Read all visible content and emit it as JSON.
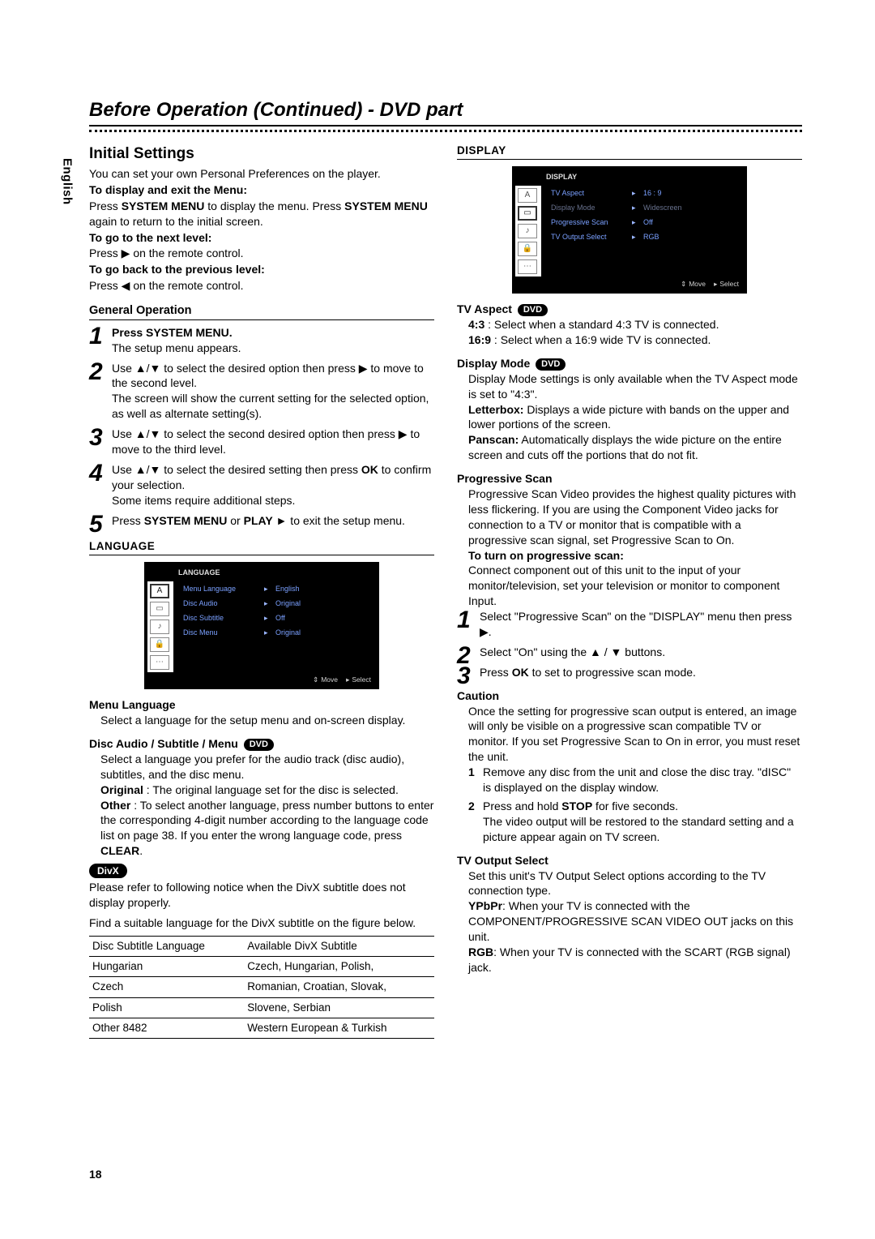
{
  "page_number": "18",
  "language_tab": "English",
  "title": "Before Operation (Continued) - DVD part",
  "initial_settings": {
    "heading": "Initial Settings",
    "intro1": "You can set your own Personal Preferences on the player.",
    "disp_exit_h": "To display and exit the Menu:",
    "disp_exit_t1": "Press ",
    "disp_exit_b1": "SYSTEM MENU",
    "disp_exit_t2": " to display the menu. Press ",
    "disp_exit_b2": "SYSTEM MENU",
    "disp_exit_t3": " again to return to the initial screen.",
    "next_h": "To go to the next level:",
    "next_t": "Press ▶ on the remote control.",
    "prev_h": "To go back to the previous level:",
    "prev_t": "Press ◀ on the remote control.",
    "general_op_h": "General Operation",
    "steps": {
      "s1a": "Press SYSTEM MENU.",
      "s1b": "The setup menu appears.",
      "s2a": "Use ▲/▼ to select the desired option then press ▶ to move to the second level.",
      "s2b": "The screen will show the current setting for the selected option, as well as alternate setting(s).",
      "s3": "Use ▲/▼ to select the second desired option then press ▶ to move to the third level.",
      "s4a_1": "Use ▲/▼ to select the desired setting then press ",
      "s4a_b": "OK",
      "s4a_2": " to confirm your selection.",
      "s4b": "Some items require additional steps.",
      "s5_1": "Press ",
      "s5_b1": "SYSTEM MENU",
      "s5_2": " or ",
      "s5_b2": "PLAY",
      "s5_3": " ► to exit the setup menu."
    }
  },
  "language": {
    "heading": "LANGUAGE",
    "osd_title": "LANGUAGE",
    "rows": [
      {
        "label": "Menu Language",
        "value": "English"
      },
      {
        "label": "Disc Audio",
        "value": "Original"
      },
      {
        "label": "Disc Subtitle",
        "value": "Off"
      },
      {
        "label": "Disc Menu",
        "value": "Original"
      }
    ],
    "osd_footer_move": "Move",
    "osd_footer_select": "Select",
    "menu_lang_h": "Menu Language",
    "menu_lang_t": "Select a language for the setup menu and on-screen display.",
    "dasm_h": "Disc Audio / Subtitle / Menu",
    "dasm_pill": "DVD",
    "dasm_t": "Select a language you prefer for the audio track (disc audio), subtitles, and the disc menu.",
    "orig_b": "Original",
    "orig_t": " : The original language set for the disc is selected.",
    "other_b": "Other",
    "other_t": " : To select another language, press number buttons to enter the corresponding 4-digit number according to the language code list on page 38. If you enter the wrong language code, press ",
    "other_clear": "CLEAR",
    "divx_pill": "DivX",
    "divx_t1": "Please refer to following notice when the DivX subtitle does not display properly.",
    "divx_t2": "Find a suitable language for the DivX subtitle on the figure below.",
    "table_h1": "Disc Subtitle Language",
    "table_h2": "Available DivX Subtitle",
    "table_rows": [
      {
        "c1": "Hungarian",
        "c2": "Czech, Hungarian, Polish,"
      },
      {
        "c1": "Czech",
        "c2": "Romanian, Croatian, Slovak,"
      },
      {
        "c1": "Polish",
        "c2": "Slovene, Serbian"
      },
      {
        "c1": "Other 8482",
        "c2": "Western European & Turkish"
      }
    ]
  },
  "display": {
    "heading": "DISPLAY",
    "osd_title": "DISPLAY",
    "rows": [
      {
        "label": "TV Aspect",
        "value": "16 : 9"
      },
      {
        "label": "Display Mode",
        "value": "Widescreen",
        "dim": true
      },
      {
        "label": "Progressive Scan",
        "value": "Off"
      },
      {
        "label": "TV Output Select",
        "value": "RGB"
      }
    ],
    "osd_footer_move": "Move",
    "osd_footer_select": "Select",
    "tva_h": "TV Aspect",
    "tva_pill": "DVD",
    "tva_43b": "4:3",
    "tva_43": " : Select when a standard 4:3 TV is connected.",
    "tva_169b": "16:9",
    "tva_169": " : Select when a 16:9 wide TV is connected.",
    "dm_h": "Display Mode",
    "dm_pill": "DVD",
    "dm_t": "Display Mode settings is only available when the TV Aspect mode is set to \"4:3\".",
    "dm_lb_b": "Letterbox:",
    "dm_lb": " Displays a wide picture with bands on the upper and lower portions of the screen.",
    "dm_ps_b": "Panscan:",
    "dm_ps": " Automatically displays the wide picture on the entire screen and cuts off the portions that do not fit.",
    "ps_h": "Progressive Scan",
    "ps_t": "Progressive Scan Video provides the highest quality pictures with less flickering. If you are using the Component Video jacks for connection to a TV or monitor that is compatible with a progressive scan signal, set Progressive Scan to On.",
    "ps_turn_h": "To turn on progressive scan:",
    "ps_turn_t": "Connect component out of this unit to the input of your monitor/television, set your television or monitor to component Input.",
    "ps_steps": {
      "s1": "Select \"Progressive Scan\" on the \"DISPLAY\" menu then press ▶.",
      "s2": "Select \"On\" using the ▲ / ▼ buttons.",
      "s3_1": "Press ",
      "s3_b": "OK",
      "s3_2": " to set to progressive scan mode."
    },
    "caution_h": "Caution",
    "caution_t": "Once the setting for progressive scan output is entered, an image will only be visible on a progressive scan compatible TV or monitor. If you set Progressive Scan to On in error, you must reset the unit.",
    "caution_steps": {
      "s1": "Remove any disc from the unit and close the disc tray. \"dISC\" is displayed on the display window.",
      "s2_1": "Press and hold ",
      "s2_b": "STOP",
      "s2_2": " for five seconds.",
      "s2b": "The video output will be restored to the standard setting and a picture appear again on TV screen."
    },
    "tvo_h": "TV Output Select",
    "tvo_t": "Set this unit's TV Output Select options according to the TV connection type.",
    "tvo_yb": "YPbPr",
    "tvo_y": ": When your TV is connected with the COMPONENT/PROGRESSIVE SCAN VIDEO OUT jacks on this unit.",
    "tvo_rb": "RGB",
    "tvo_r": ": When your TV is connected with the SCART (RGB signal) jack."
  }
}
